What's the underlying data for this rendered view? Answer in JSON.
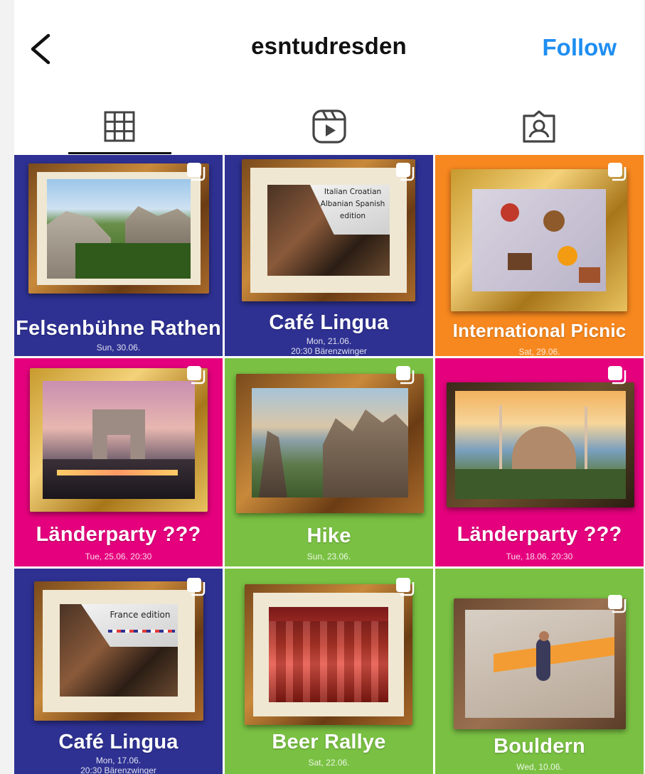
{
  "header": {
    "username": "esntudresden",
    "follow_label": "Follow"
  },
  "tabs": [
    {
      "icon": "grid-icon",
      "active": true
    },
    {
      "icon": "reels-icon",
      "active": false
    },
    {
      "icon": "tagged-icon",
      "active": false
    }
  ],
  "colors": {
    "accent": "#1f8ef1",
    "blue": "#2e3192",
    "orange": "#f7881f",
    "magenta": "#e5007d",
    "green": "#7ac143"
  },
  "posts": [
    {
      "title": "Felsenbühne Rathen",
      "subtitle": "Sun, 30.06.",
      "bg": "blue",
      "multi": true
    },
    {
      "title": "Café Lingua",
      "subtitle": "Mon, 21.06.\n20:30 Bärenzwinger",
      "bg": "blue",
      "overlay": "Italian Croatian\nAlbanian Spanish\nedition",
      "multi": true
    },
    {
      "title": "International Picnic",
      "subtitle": "Sat, 29.06.",
      "bg": "orange",
      "multi": true
    },
    {
      "title": "Länderparty ???",
      "subtitle": "Tue, 25.06.   20:30",
      "bg": "magenta",
      "multi": true
    },
    {
      "title": "Hike",
      "subtitle": "Sun, 23.06.",
      "bg": "green",
      "multi": true
    },
    {
      "title": "Länderparty ???",
      "subtitle": "Tue, 18.06.   20:30",
      "bg": "magenta",
      "multi": true
    },
    {
      "title": "Café Lingua",
      "subtitle": "Mon, 17.06.\n20:30 Bärenzwinger",
      "bg": "blue",
      "overlay": "France edition",
      "multi": true
    },
    {
      "title": "Beer Rallye",
      "subtitle": "Sat, 22.06.",
      "bg": "green",
      "multi": true
    },
    {
      "title": "Bouldern",
      "subtitle": "Wed, 10.06.",
      "bg": "green",
      "multi": true
    }
  ]
}
